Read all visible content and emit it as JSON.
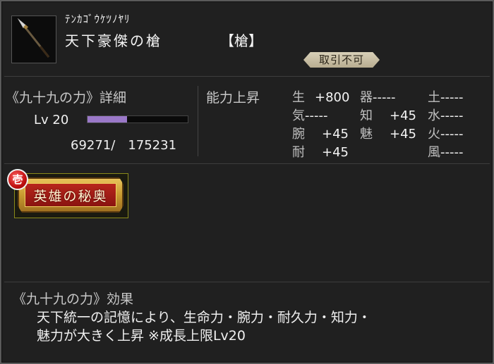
{
  "item": {
    "reading": "ﾃﾝｶｺﾞｳｹﾂﾉﾔﾘ",
    "name": "天下豪傑の槍",
    "type": "【槍】",
    "trade_status": "取引不可",
    "icon": "spear-icon"
  },
  "detail": {
    "title": "《九十九の力》詳細",
    "level_label": "Lv 20",
    "exp_text": "69271/　175231",
    "exp_fraction": 0.395
  },
  "ability": {
    "title": "能力上昇",
    "stats": [
      {
        "label": "生",
        "value": "+800"
      },
      {
        "label": "器",
        "value": "-----"
      },
      {
        "label": "土",
        "value": "-----"
      },
      {
        "label": "気",
        "value": "-----"
      },
      {
        "label": "知",
        "value": "+45"
      },
      {
        "label": "水",
        "value": "-----"
      },
      {
        "label": "腕",
        "value": "+45"
      },
      {
        "label": "魅",
        "value": "+45"
      },
      {
        "label": "火",
        "value": "-----"
      },
      {
        "label": "耐",
        "value": "+45"
      },
      {
        "label": "風",
        "value": "-----"
      }
    ]
  },
  "skill": {
    "badge": "壱",
    "label": "英雄の秘奥"
  },
  "effect": {
    "title": "《九十九の力》効果",
    "line1": "天下統一の記憶により、生命力・腕力・耐久力・知力・",
    "line2": "魅力が大きく上昇 ※成長上限Lv20"
  },
  "colors": {
    "exp_bar": "#9a78c8",
    "skill_gold": "#e8c35a",
    "skill_red": "#b8261c",
    "badge_red": "#c01010"
  }
}
